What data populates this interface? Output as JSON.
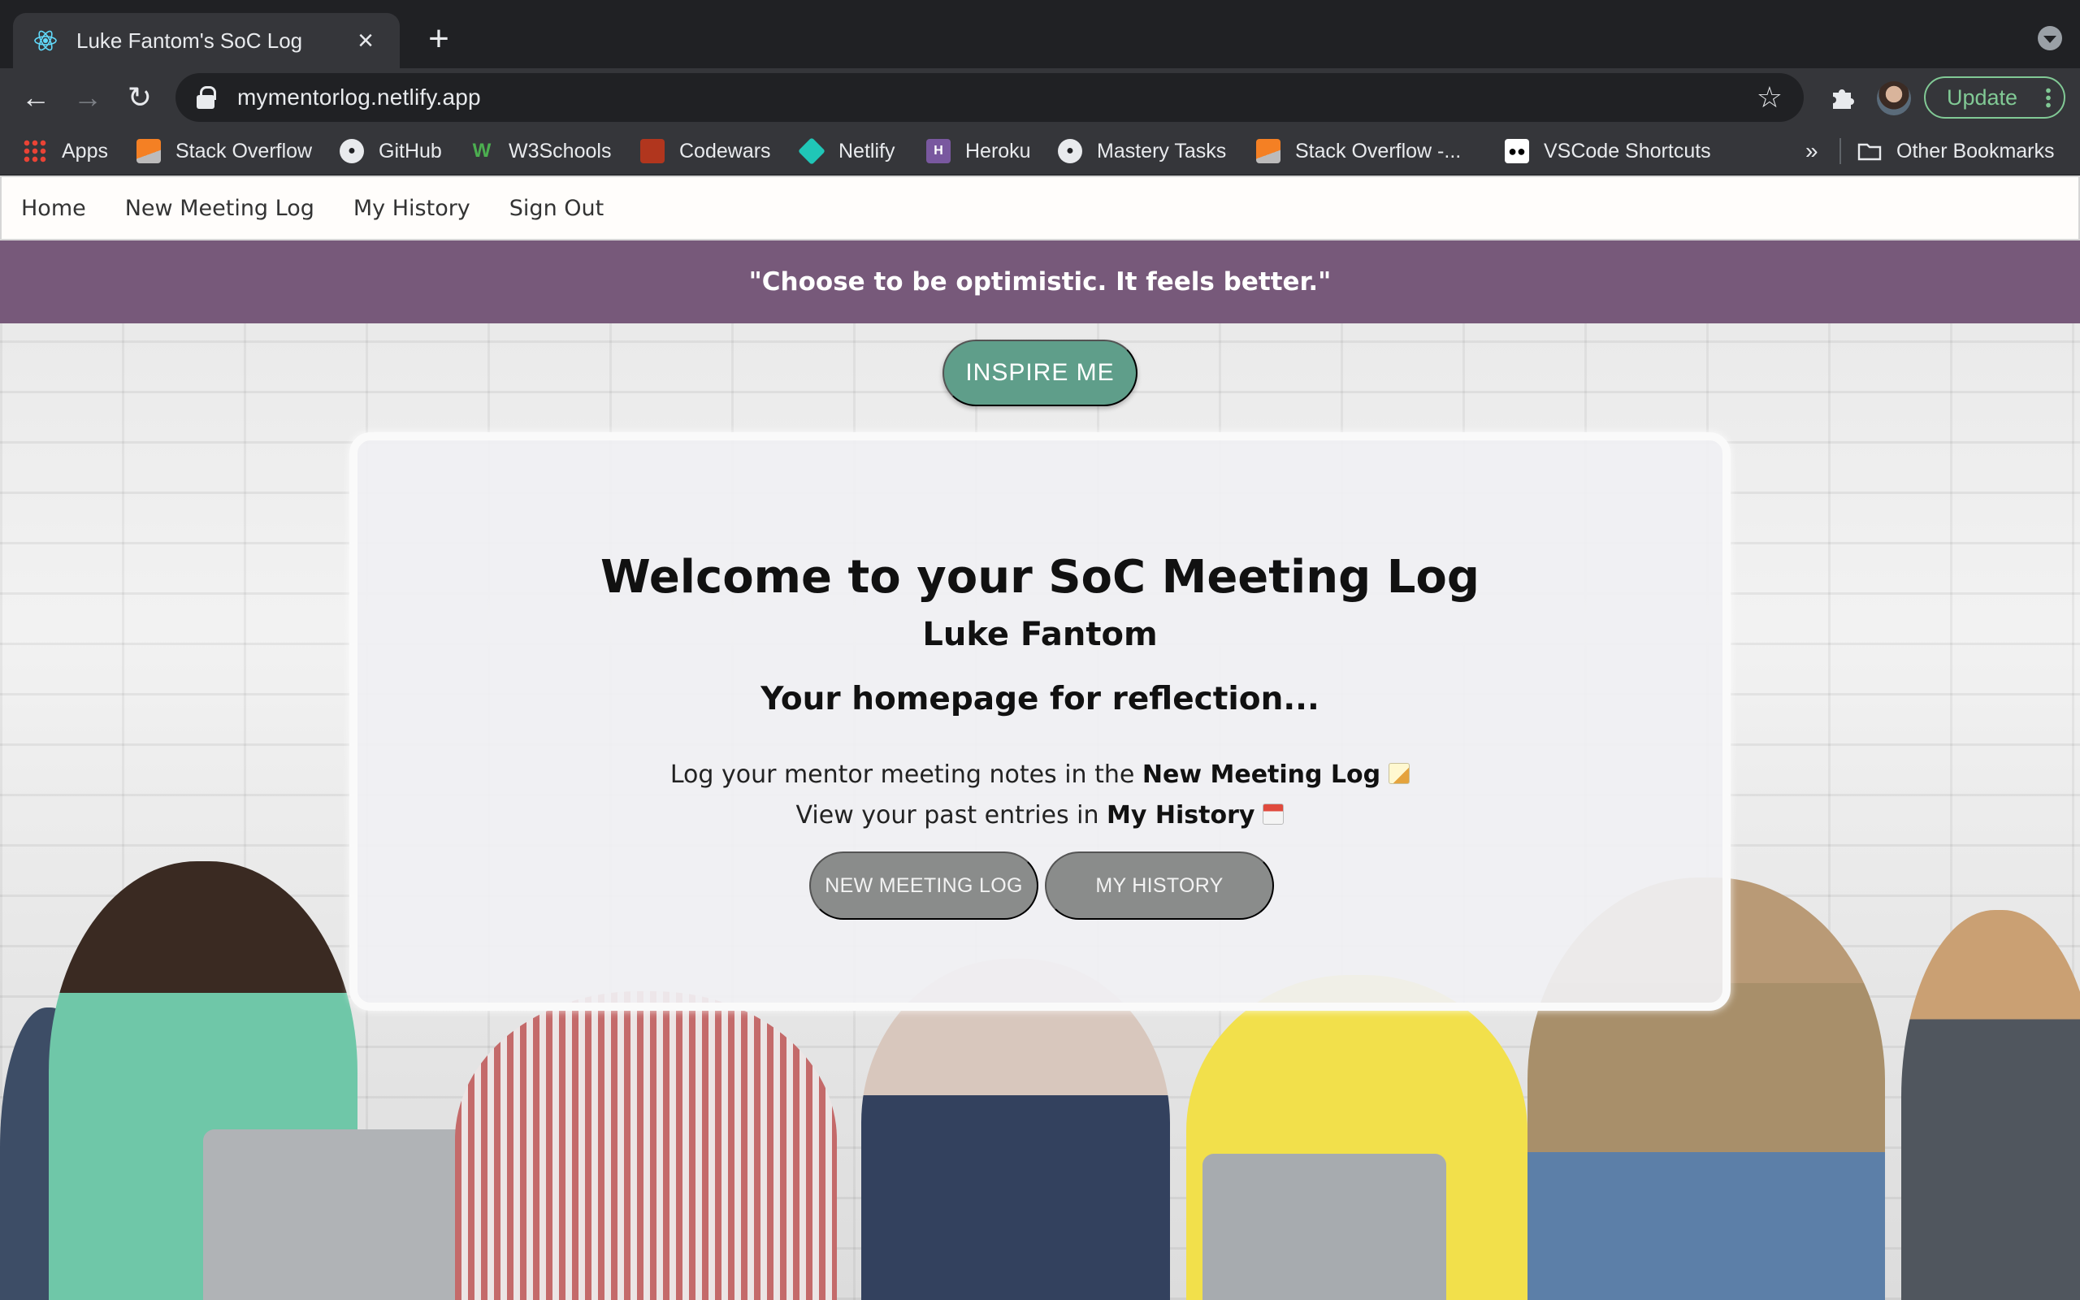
{
  "browser": {
    "tab_title": "Luke Fantom's SoC Log",
    "url": "mymentorlog.netlify.app",
    "update_label": "Update",
    "bookmarks": [
      {
        "label": "Apps",
        "icon": "apps-grid-icon"
      },
      {
        "label": "Stack Overflow",
        "icon": "stackoverflow-icon"
      },
      {
        "label": "GitHub",
        "icon": "github-icon"
      },
      {
        "label": "W3Schools",
        "icon": "w3schools-icon"
      },
      {
        "label": "Codewars",
        "icon": "codewars-icon"
      },
      {
        "label": "Netlify",
        "icon": "netlify-icon"
      },
      {
        "label": "Heroku",
        "icon": "heroku-icon"
      },
      {
        "label": "Mastery Tasks",
        "icon": "github-icon"
      },
      {
        "label": "Stack Overflow -...",
        "icon": "stackoverflow-icon"
      },
      {
        "label": "VSCode Shortcuts",
        "icon": "medium-icon"
      }
    ],
    "overflow_label": "»",
    "other_bookmarks": "Other Bookmarks"
  },
  "navbar": {
    "links": [
      "Home",
      "New Meeting Log",
      "My History",
      "Sign Out"
    ]
  },
  "quote": "\"Choose to be optimistic. It feels better.\"",
  "inspire_label": "INSPIRE ME",
  "card": {
    "title": "Welcome to your SoC Meeting Log",
    "user": "Luke Fantom",
    "tagline": "Your homepage for reflection...",
    "line1_prefix": "Log your mentor meeting notes in the ",
    "line1_bold": "New Meeting Log",
    "line2_prefix": "View your past entries in ",
    "line2_bold": "My History",
    "btn_new": "NEW MEETING LOG",
    "btn_history": "MY HISTORY"
  },
  "colors": {
    "quote_bar": "#77597a",
    "inspire_button": "#5f9e8a",
    "card_button": "#8a8c8b",
    "update_green": "#81c995"
  }
}
